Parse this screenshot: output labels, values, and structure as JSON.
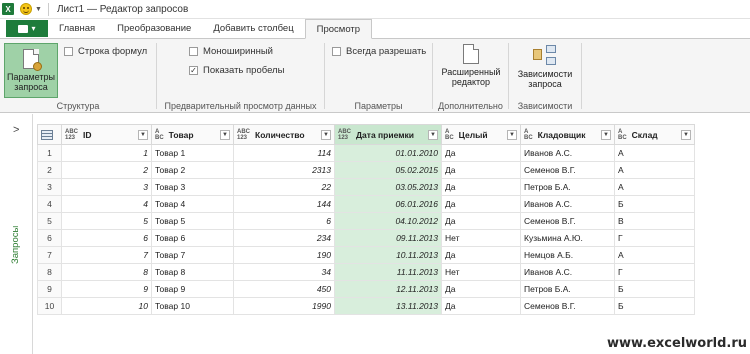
{
  "window": {
    "logo": "X",
    "title": "Лист1 — Редактор запросов"
  },
  "tabs": {
    "file_label": "",
    "items": [
      "Главная",
      "Преобразование",
      "Добавить столбец",
      "Просмотр"
    ],
    "active_index": 3
  },
  "ribbon": {
    "structure": {
      "label": "Структура",
      "query_params_button": "Параметры запроса",
      "formula_bar_checkbox": "Строка формул",
      "formula_bar_checked": false
    },
    "preview": {
      "label": "Предварительный просмотр данных",
      "monospace_checkbox": "Моноширинный",
      "monospace_checked": false,
      "whitespace_checkbox": "Показать пробелы",
      "whitespace_checked": true
    },
    "parameters": {
      "label": "Параметры",
      "always_allow_checkbox": "Всегда разрешать",
      "always_allow_checked": false
    },
    "advanced": {
      "label": "Дополнительно",
      "advanced_editor_button": "Расширенный редактор"
    },
    "dependencies": {
      "label": "Зависимости",
      "query_dependencies_button": "Зависимости запроса"
    }
  },
  "leftpane": {
    "label": "Запросы",
    "chevron": "chevron-right-icon"
  },
  "table": {
    "columns": [
      {
        "name": "ID",
        "type": "123"
      },
      {
        "name": "Товар",
        "type": "ABC"
      },
      {
        "name": "Количество",
        "type": "123"
      },
      {
        "name": "Дата приемки",
        "type": "123"
      },
      {
        "name": "Целый",
        "type": "ABC"
      },
      {
        "name": "Кладовщик",
        "type": "ABC"
      },
      {
        "name": "Склад",
        "type": "ABC"
      }
    ],
    "rows": [
      [
        "1",
        "Товар 1",
        "114",
        "01.01.2010",
        "Да",
        "Иванов А.С.",
        "А"
      ],
      [
        "2",
        "Товар 2",
        "2313",
        "05.02.2015",
        "Да",
        "Семенов В.Г.",
        "А"
      ],
      [
        "3",
        "Товар 3",
        "22",
        "03.05.2013",
        "Да",
        "Петров Б.А.",
        "А"
      ],
      [
        "4",
        "Товар 4",
        "144",
        "06.01.2016",
        "Да",
        "Иванов А.С.",
        "Б"
      ],
      [
        "5",
        "Товар 5",
        "6",
        "04.10.2012",
        "Да",
        "Семенов В.Г.",
        "В"
      ],
      [
        "6",
        "Товар 6",
        "234",
        "09.11.2013",
        "Нет",
        "Кузьмина А.Ю.",
        "Г"
      ],
      [
        "7",
        "Товар 7",
        "190",
        "10.11.2013",
        "Да",
        "Немцов А.Б.",
        "А"
      ],
      [
        "8",
        "Товар 8",
        "34",
        "11.11.2013",
        "Нет",
        "Иванов А.С.",
        "Г"
      ],
      [
        "9",
        "Товар 9",
        "450",
        "12.11.2013",
        "Да",
        "Петров Б.А.",
        "Б"
      ],
      [
        "10",
        "Товар 10",
        "1990",
        "13.11.2013",
        "Да",
        "Семенов В.Г.",
        "Б"
      ]
    ],
    "selected_column_index": 3
  },
  "watermark": "www.excelworld.ru",
  "colors": {
    "accent_green": "#1e7c3b",
    "selected_column": "#d8eedc",
    "selected_button": "#9fd1a7"
  }
}
